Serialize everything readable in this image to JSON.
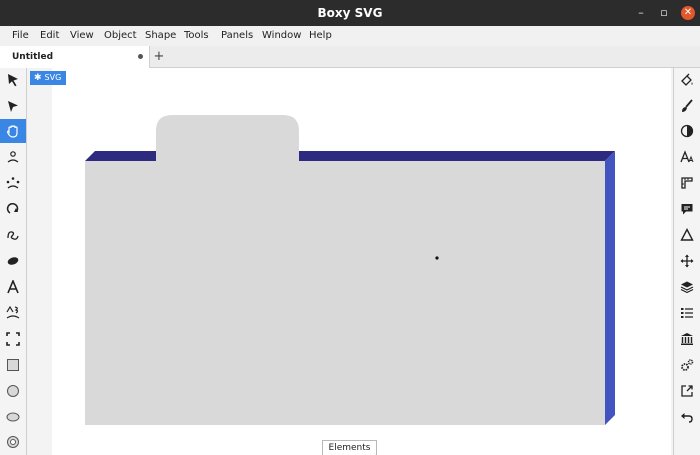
{
  "window": {
    "title": "Boxy SVG",
    "minimize_glyph": "–",
    "maximize_glyph": "▫",
    "close_glyph": "✕"
  },
  "menu": {
    "items": [
      "File",
      "Edit",
      "View",
      "Object",
      "Shape",
      "Tools",
      "Panels",
      "Window",
      "Help"
    ]
  },
  "tabs": {
    "items": [
      {
        "label": "Untitled",
        "unsaved": true
      }
    ],
    "add_glyph": "+"
  },
  "canvas": {
    "root_label": "SVG",
    "elements_panel_label": "Elements",
    "artwork": {
      "folder_face_color": "#d9d9d9",
      "top_edge_color": "#2d2a80",
      "side_edge_color": "#4353c0",
      "background": "#ffffff"
    }
  },
  "left_tools": [
    {
      "name": "select-tool-icon",
      "active": false
    },
    {
      "name": "edit-tool-icon",
      "active": false
    },
    {
      "name": "pan-tool-icon",
      "active": true
    },
    {
      "name": "freeform-tool-icon",
      "active": false
    },
    {
      "name": "triangle-tool-icon",
      "active": false
    },
    {
      "name": "arc-tool-icon",
      "active": false
    },
    {
      "name": "pen-tool-icon",
      "active": false
    },
    {
      "name": "blob-tool-icon",
      "active": false
    },
    {
      "name": "text-tool-icon",
      "active": false
    },
    {
      "name": "warp-tool-icon",
      "active": false
    },
    {
      "name": "crop-tool-icon",
      "active": false
    },
    {
      "name": "rectangle-tool-icon",
      "active": false
    },
    {
      "name": "circle-tool-icon",
      "active": false
    },
    {
      "name": "ellipse-tool-icon",
      "active": false
    },
    {
      "name": "ring-tool-icon",
      "active": false
    }
  ],
  "right_panels": [
    "fill-panel-icon",
    "stroke-panel-icon",
    "compositing-panel-icon",
    "typography-panel-icon",
    "ruler-panel-icon",
    "comment-panel-icon",
    "geometry-panel-icon",
    "transform-panel-icon",
    "layers-panel-icon",
    "list-panel-icon",
    "library-panel-icon",
    "gears-panel-icon",
    "export-panel-icon",
    "undo-panel-icon"
  ],
  "colors": {
    "accent": "#3a86e5",
    "titlebar": "#2c2c2c",
    "close_button": "#e2572b"
  }
}
